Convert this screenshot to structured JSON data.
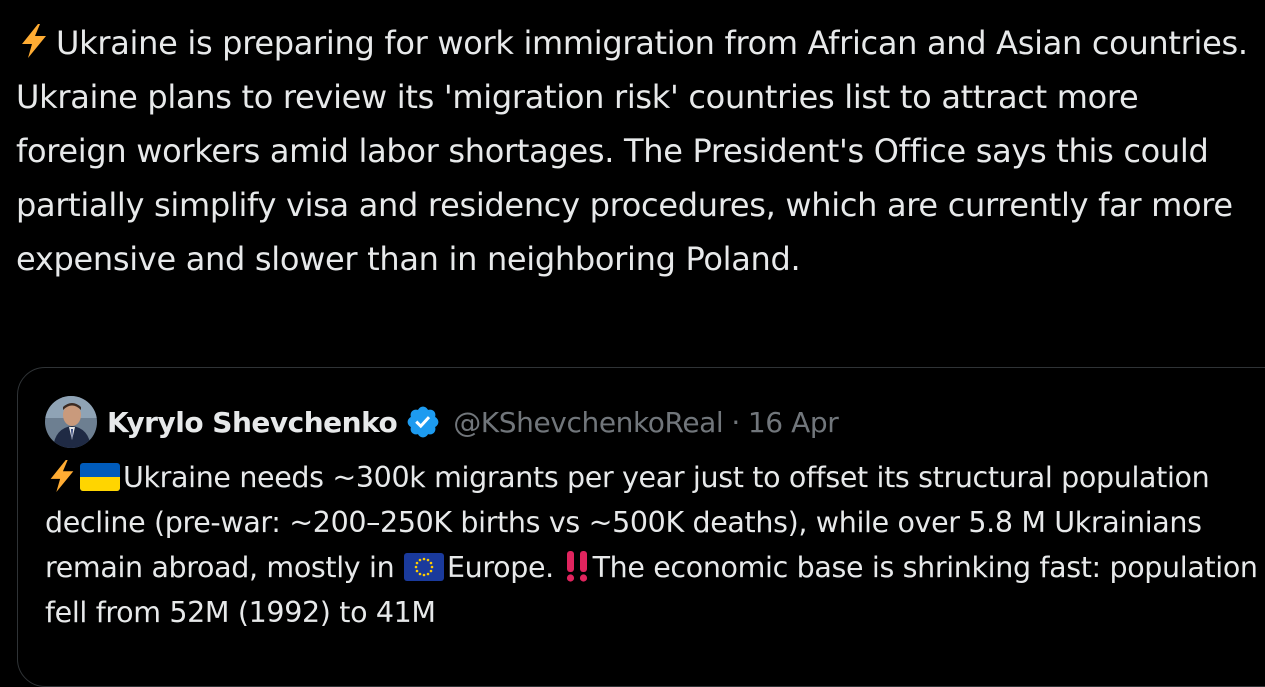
{
  "tweet": {
    "lead_icon": "lightning-bolt-emoji",
    "text": "Ukraine is preparing for work immigration from African and Asian countries. Ukraine plans to review its 'migration risk' countries list to attract more foreign workers amid labor shortages. The President's Office says this could partially simplify visa and residency procedures, which are currently far more expensive and slower than in neighboring Poland."
  },
  "quoted_tweet": {
    "author_name": "Kyrylo Shevchenko",
    "handle": "@KShevchenkoReal",
    "separator": "·",
    "date": "16 Apr",
    "verified_icon": "verified-badge-icon",
    "body": {
      "part1": "Ukraine needs ~300k migrants per year just to offset its structural population decline (pre-war: ~200–250K births vs ~500K deaths), while over 5.8 M Ukrainians remain abroad, mostly in ",
      "part2": "Europe. ",
      "part3": "The economic base is shrinking fast: population fell from 52M (1992) to 41M",
      "icons": [
        "lightning-bolt-emoji",
        "ukraine-flag-emoji",
        "eu-flag-emoji",
        "double-exclamation-emoji"
      ]
    }
  },
  "colors": {
    "background": "#000000",
    "text_primary": "#e7e9ea",
    "text_secondary": "#71767b",
    "border": "#2f3336",
    "verified_blue": "#1d9bf0"
  }
}
